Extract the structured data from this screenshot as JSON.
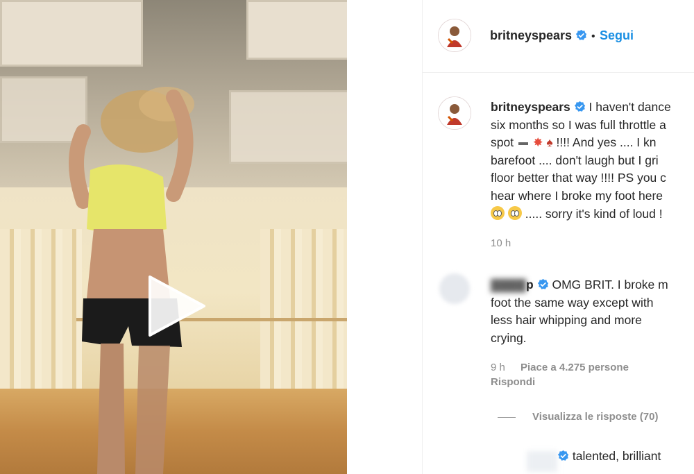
{
  "post": {
    "username": "britneyspears",
    "follow_separator": "•",
    "follow_label": "Segui",
    "caption_lines": [
      "I haven't dance",
      "six months so I was full throttle a",
      "spot",
      "!!!! And yes .... I kn",
      "barefoot .... don't laugh but I gri",
      "floor better that way !!!! PS you c",
      "hear where I broke my foot here",
      "..... sorry it's kind of loud !"
    ],
    "caption_time": "10 h"
  },
  "comment": {
    "username_fragment": "p",
    "text_first": "OMG BRIT. I broke m",
    "text_lines": [
      "foot the same way except with",
      "less hair whipping and more",
      "crying."
    ],
    "time": "9 h",
    "likes": "Piace a 4.275 persone",
    "reply_label": "Rispondi",
    "view_replies": "Visualizza le risposte (70)"
  },
  "next_comment": {
    "text": "talented, brilliant"
  },
  "icons": {
    "verified": "verified-badge-icon",
    "play": "play-icon"
  },
  "colors": {
    "link_blue": "#1a8fe3",
    "verified_blue": "#3897f0",
    "text": "#262626",
    "muted": "#8e8e8e"
  }
}
